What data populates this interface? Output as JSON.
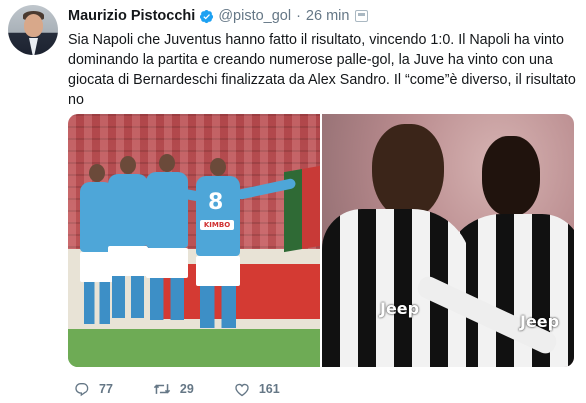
{
  "tweet": {
    "author_name": "Maurizio Pistocchi",
    "handle": "@pisto_gol",
    "separator": "·",
    "time": "26 min",
    "text": "Sia Napoli che Juventus hanno fatto il risultato, vincendo 1:0. Il Napoli ha vinto dominando la partita e creando numerose palle-gol, la Juve ha vinto con una giocata di Bernardeschi finalizzata da Alex Sandro. Il “come”è diverso, il risultato no",
    "media": [
      {
        "icon": "napoli-celebration-photo",
        "jersey_number": "8",
        "sponsor": "KIMBO"
      },
      {
        "icon": "juventus-players-photo",
        "sponsor": "Jeep"
      }
    ],
    "actions": {
      "replies": "77",
      "retweets": "29",
      "likes": "161"
    }
  },
  "colors": {
    "verified": "#1da1f2",
    "text": "#14171a",
    "muted": "#657786"
  }
}
